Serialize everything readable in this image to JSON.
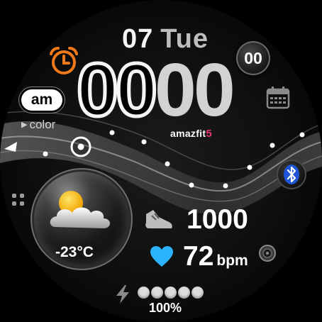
{
  "date": {
    "day_number": "07",
    "weekday": "Tue"
  },
  "time": {
    "hours": "00",
    "minutes": "00",
    "seconds": "00",
    "ampm": "am"
  },
  "labels": {
    "color_label": "color",
    "brand": "amazfit",
    "brand_mark": "5"
  },
  "weather": {
    "temperature": "-23°C",
    "condition_icon": "partly-cloudy-icon"
  },
  "activity": {
    "steps": "1000",
    "heart_rate": "72",
    "heart_rate_unit": "bpm"
  },
  "battery": {
    "percent_text": "100%",
    "level": 1.0,
    "dots_filled": 5,
    "dots_total": 5
  },
  "icons": [
    "alarm-icon",
    "calendar-icon",
    "bluetooth-icon",
    "apps-grid-icon",
    "target-icon",
    "shoe-icon",
    "heart-icon",
    "measure-icon",
    "lightning-icon"
  ],
  "colors": {
    "alarm": "#f07a1a",
    "heart": "#2bb3ff",
    "bluetooth": "#1f56d8",
    "brand_accent": "#e8346a",
    "text": "#ffffff"
  }
}
